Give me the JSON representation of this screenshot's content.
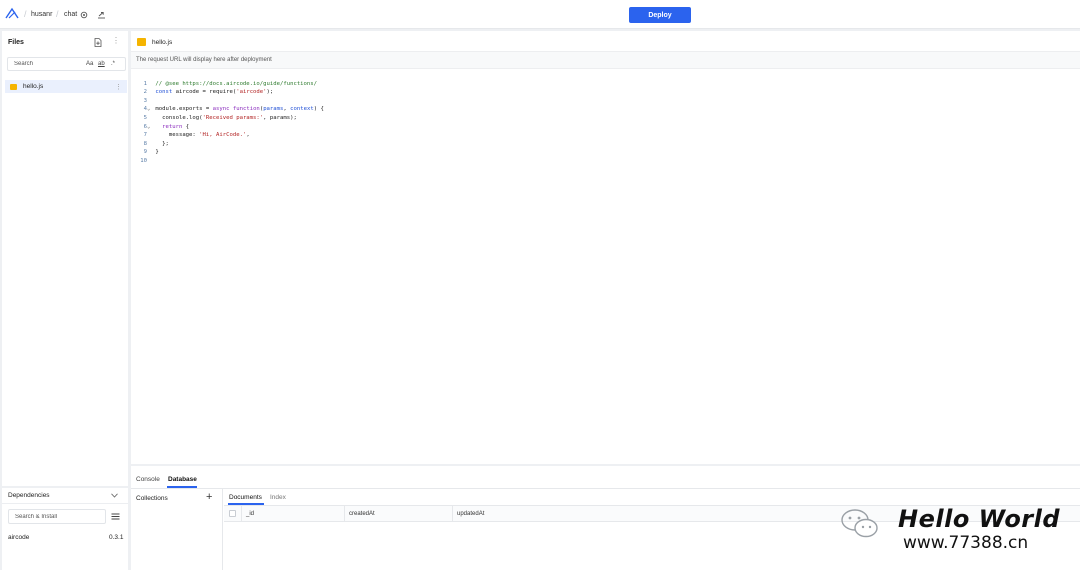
{
  "topbar": {
    "breadcrumb": [
      "husanr",
      "chat"
    ],
    "deploy_label": "Deploy"
  },
  "sidebar": {
    "title": "Files",
    "search_placeholder": "Search",
    "search_opt_case": "Aa",
    "search_opt_word": "ab",
    "search_opt_regex": ".*",
    "files": [
      {
        "name": "hello.js",
        "icon": "js-file-icon",
        "selected": true
      }
    ]
  },
  "dependencies": {
    "title": "Dependencies",
    "search_placeholder": "Search & Install",
    "items": [
      {
        "name": "aircode",
        "version": "0.3.1"
      }
    ]
  },
  "editor": {
    "tab_label": "hello.js",
    "url_notice": "The request URL will display here after deployment",
    "line_numbers": [
      "1",
      "2",
      "3",
      "4",
      "5",
      "6",
      "7",
      "8",
      "9",
      "10"
    ],
    "foldable_lines": [
      4,
      6
    ]
  },
  "bottom_panel": {
    "tabs": [
      "Console",
      "Database"
    ],
    "active_tab": "Database",
    "collections_label": "Collections",
    "subtabs": [
      "Documents",
      "Index"
    ],
    "active_subtab": "Documents",
    "columns": [
      "_id",
      "createdAt",
      "updatedAt"
    ]
  },
  "watermark": {
    "title": "Hello World",
    "url": "www.77388.cn"
  },
  "colors": {
    "accent": "#2b63ee",
    "js_icon": "#f5b400",
    "selected_row": "#eaf0fd"
  }
}
